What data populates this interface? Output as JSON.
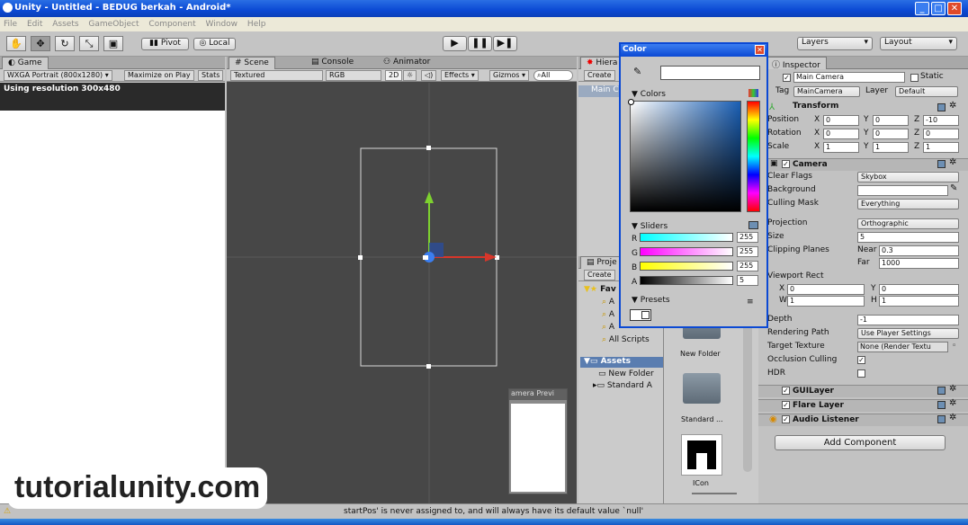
{
  "window": {
    "title": "Unity - Untitled - BEDUG berkah - Android*"
  },
  "menu": [
    "File",
    "Edit",
    "Assets",
    "GameObject",
    "Component",
    "Window",
    "Help"
  ],
  "toolbar": {
    "pivot": "Pivot",
    "local": "Local",
    "layers": "Layers",
    "layout": "Layout"
  },
  "game": {
    "tab": "Game",
    "resolution_dd": "WXGA Portrait (800x1280)",
    "maximize": "Maximize on Play",
    "stats": "Stats",
    "message": "Using resolution 300x480"
  },
  "scene": {
    "tabs": [
      "Scene",
      "Console",
      "Animator"
    ],
    "render_mode": "Textured",
    "color_mode": "RGB",
    "mode_2d": "2D",
    "effects": "Effects",
    "gizmos": "Gizmos",
    "search": "All",
    "camera_preview": "amera Previ"
  },
  "hierarchy": {
    "tab": "Hiera",
    "create": "Create",
    "item": "Main C"
  },
  "project": {
    "tab": "Proje",
    "create": "Create",
    "favorites_label": "Fav",
    "favorites": [
      "A",
      "A",
      "A",
      "All Scripts"
    ],
    "assets_label": "Assets",
    "assets": [
      "New Folder",
      "Standard A"
    ],
    "grid_items": [
      "New Folder",
      "Standard ...",
      "ICon"
    ]
  },
  "color_picker": {
    "title": "Color",
    "colors_label": "Colors",
    "sliders_label": "Sliders",
    "presets_label": "Presets",
    "sliders": [
      {
        "label": "R",
        "value": "255"
      },
      {
        "label": "G",
        "value": "255"
      },
      {
        "label": "B",
        "value": "255"
      },
      {
        "label": "A",
        "value": "5"
      }
    ]
  },
  "inspector": {
    "tab": "Inspector",
    "object_name": "Main Camera",
    "static": "Static",
    "tag_label": "Tag",
    "tag_value": "MainCamera",
    "layer_label": "Layer",
    "layer_value": "Default",
    "transform": {
      "title": "Transform",
      "position_label": "Position",
      "rotation_label": "Rotation",
      "scale_label": "Scale",
      "position": [
        "0",
        "0",
        "-10"
      ],
      "rotation": [
        "0",
        "0",
        "0"
      ],
      "scale": [
        "1",
        "1",
        "1"
      ],
      "axis": [
        "X",
        "Y",
        "Z"
      ]
    },
    "camera": {
      "title": "Camera",
      "clear_flags_label": "Clear Flags",
      "clear_flags": "Skybox",
      "background_label": "Background",
      "culling_mask_label": "Culling Mask",
      "culling_mask": "Everything",
      "projection_label": "Projection",
      "projection": "Orthographic",
      "size_label": "Size",
      "size": "5",
      "clipping_label": "Clipping Planes",
      "near_label": "Near",
      "near": "0.3",
      "far_label": "Far",
      "far": "1000",
      "viewport_label": "Viewport Rect",
      "vp_x_label": "X",
      "vp_x": "0",
      "vp_y_label": "Y",
      "vp_y": "0",
      "vp_w_label": "W",
      "vp_w": "1",
      "vp_h_label": "H",
      "vp_h": "1",
      "depth_label": "Depth",
      "depth": "-1",
      "rendering_path_label": "Rendering Path",
      "rendering_path": "Use Player Settings",
      "target_texture_label": "Target Texture",
      "target_texture": "None (Render Textu",
      "occlusion_label": "Occlusion Culling",
      "hdr_label": "HDR"
    },
    "components": [
      "GUILayer",
      "Flare Layer",
      "Audio Listener"
    ],
    "add_component": "Add Component"
  },
  "status": {
    "message": "startPos' is never assigned to, and will always have its default value `null'"
  },
  "watermark": "tutorialunity.com",
  "colors": {
    "accent": "#0b49d4",
    "scene_bg": "#474747",
    "picker_blue": "#1a5fb4"
  }
}
